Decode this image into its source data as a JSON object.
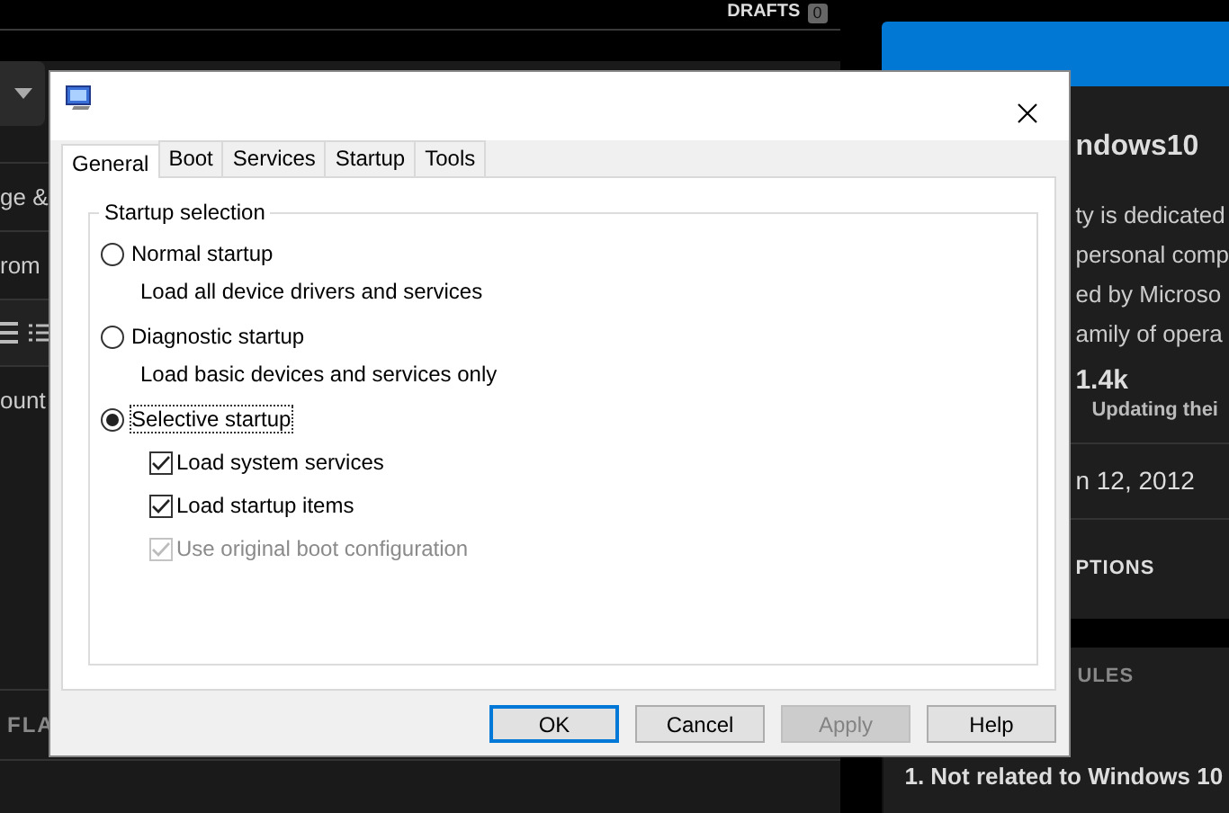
{
  "background_page": {
    "header": {
      "label": "DRAFTS",
      "count": "0"
    },
    "left_texts": [
      "ge &",
      "rom",
      "ount"
    ],
    "left_footer": "FLA",
    "right_panel": {
      "title": "ndows10",
      "description_lines": [
        "ty is dedicated",
        "personal comp",
        "ed by Microso",
        "amily of opera"
      ],
      "stat_value": "1.4k",
      "stat_label": "Updating thei",
      "date": "n 12, 2012",
      "section_1": "PTIONS",
      "section_2": "ULES",
      "rule": "1. Not related to Windows 10"
    }
  },
  "dialog": {
    "tabs": [
      {
        "label": "General",
        "selected": true
      },
      {
        "label": "Boot",
        "selected": false
      },
      {
        "label": "Services",
        "selected": false
      },
      {
        "label": "Startup",
        "selected": false
      },
      {
        "label": "Tools",
        "selected": false
      }
    ],
    "group_title": "Startup selection",
    "options": [
      {
        "kind": "radio",
        "label": "Normal startup",
        "description": "Load all device drivers and services",
        "selected": false,
        "focused": false
      },
      {
        "kind": "radio",
        "label": "Diagnostic startup",
        "description": "Load basic devices and services only",
        "selected": false,
        "focused": false
      },
      {
        "kind": "radio",
        "label": "Selective startup",
        "selected": true,
        "focused": true,
        "children": [
          {
            "kind": "checkbox",
            "label": "Load system services",
            "checked": true,
            "disabled": false
          },
          {
            "kind": "checkbox",
            "label": "Load startup items",
            "checked": true,
            "disabled": false
          },
          {
            "kind": "checkbox",
            "label": "Use original boot configuration",
            "checked": true,
            "disabled": true
          }
        ]
      }
    ],
    "buttons": [
      {
        "label": "OK",
        "default": true,
        "disabled": false
      },
      {
        "label": "Cancel",
        "default": false,
        "disabled": false
      },
      {
        "label": "Apply",
        "default": false,
        "disabled": true
      },
      {
        "label": "Help",
        "default": false,
        "disabled": false
      }
    ]
  }
}
